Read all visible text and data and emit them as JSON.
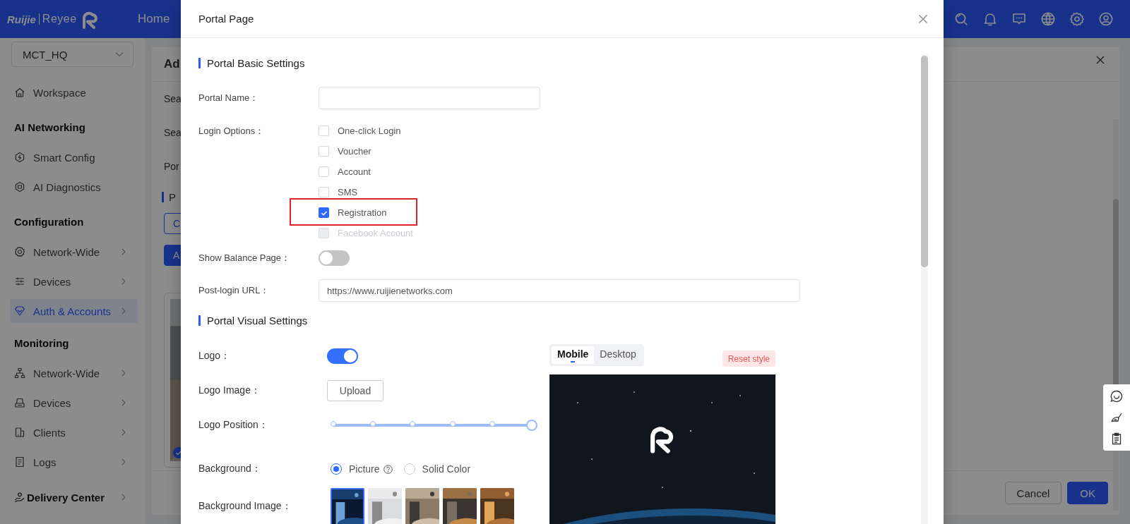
{
  "header": {
    "brand": "Ruijie",
    "product": "Reyee",
    "nav": [
      "Home"
    ]
  },
  "sidebar": {
    "site": "MCT_HQ",
    "groups": [
      {
        "items": [
          {
            "label": "Workspace",
            "kind": "item",
            "has_submenu": false,
            "selected": false
          }
        ]
      },
      {
        "title": "AI Networking",
        "items": [
          {
            "label": "Smart Config",
            "kind": "item",
            "has_submenu": false,
            "selected": false
          },
          {
            "label": "AI Diagnostics",
            "kind": "item",
            "has_submenu": false,
            "selected": false
          }
        ]
      },
      {
        "title": "Configuration",
        "items": [
          {
            "label": "Network-Wide",
            "kind": "item",
            "has_submenu": true,
            "selected": false
          },
          {
            "label": "Devices",
            "kind": "item",
            "has_submenu": true,
            "selected": false
          },
          {
            "label": "Auth & Accounts",
            "kind": "item",
            "has_submenu": true,
            "selected": true
          }
        ]
      },
      {
        "title": "Monitoring",
        "items": [
          {
            "label": "Network-Wide",
            "kind": "item",
            "has_submenu": true,
            "selected": false
          },
          {
            "label": "Devices",
            "kind": "item",
            "has_submenu": true,
            "selected": false
          },
          {
            "label": "Clients",
            "kind": "item",
            "has_submenu": true,
            "selected": false
          },
          {
            "label": "Logs",
            "kind": "item",
            "has_submenu": true,
            "selected": false
          }
        ]
      },
      {
        "items": [
          {
            "label": "Delivery Center",
            "kind": "group",
            "has_submenu": true,
            "selected": false
          }
        ]
      }
    ]
  },
  "background_panel": {
    "title": "Ad",
    "rows": [
      "Sea",
      "Sea",
      "Por"
    ],
    "section": "P",
    "buttons": [
      {
        "label": "C",
        "kind": "outline"
      },
      {
        "label": "A",
        "kind": "primary"
      }
    ],
    "card": {
      "kind": "picture",
      "checked": true
    },
    "footer_buttons": [
      {
        "label": "Cancel",
        "kind": "default"
      },
      {
        "label": "OK",
        "kind": "primary"
      }
    ]
  },
  "dialog": {
    "title": "Portal Page",
    "basic": {
      "title": "Portal Basic Settings",
      "fields": [
        {
          "kind": "input",
          "label": "Portal Name："
        },
        {
          "kind": "checkboxes",
          "label": "Login Options：",
          "options": [
            {
              "label": "One-click Login",
              "checked": false,
              "disabled": false,
              "highlighted": false
            },
            {
              "label": "Voucher",
              "checked": false,
              "disabled": false,
              "highlighted": false
            },
            {
              "label": "Account",
              "checked": false,
              "disabled": false,
              "highlighted": false
            },
            {
              "label": "SMS",
              "checked": false,
              "disabled": false,
              "highlighted": false
            },
            {
              "label": "Registration",
              "checked": true,
              "disabled": false,
              "highlighted": true
            },
            {
              "label": "Facebook Account",
              "checked": false,
              "disabled": true,
              "highlighted": false
            }
          ]
        },
        {
          "kind": "toggle",
          "label": "Show Balance Page：",
          "on": false
        },
        {
          "kind": "wideinput",
          "label": "Post-login URL：",
          "value": "https://www.ruijienetworks.com"
        }
      ]
    },
    "visual": {
      "title": "Portal Visual Settings",
      "fields": [
        {
          "kind": "toggle",
          "label": "Logo：",
          "on": true
        },
        {
          "kind": "upload",
          "label": "Logo Image：",
          "button": "Upload"
        },
        {
          "kind": "slider",
          "label": "Logo Position：",
          "level": 1
        },
        {
          "kind": "radios",
          "label": "Background：",
          "options": [
            {
              "label": "Picture",
              "selected": true,
              "help": true
            },
            {
              "label": "Solid Color",
              "selected": false,
              "help": false
            }
          ]
        },
        {
          "kind": "images",
          "label": "Background Image：",
          "images": [
            {
              "selected": true
            },
            {
              "selected": false
            },
            {
              "selected": false
            },
            {
              "selected": false
            },
            {
              "selected": false
            }
          ]
        }
      ],
      "preview": {
        "tabs": [
          {
            "label": "Mobile",
            "selected": true
          },
          {
            "label": "Desktop",
            "selected": false
          }
        ],
        "reset_button": "Reset style",
        "kind": "picture"
      }
    }
  }
}
